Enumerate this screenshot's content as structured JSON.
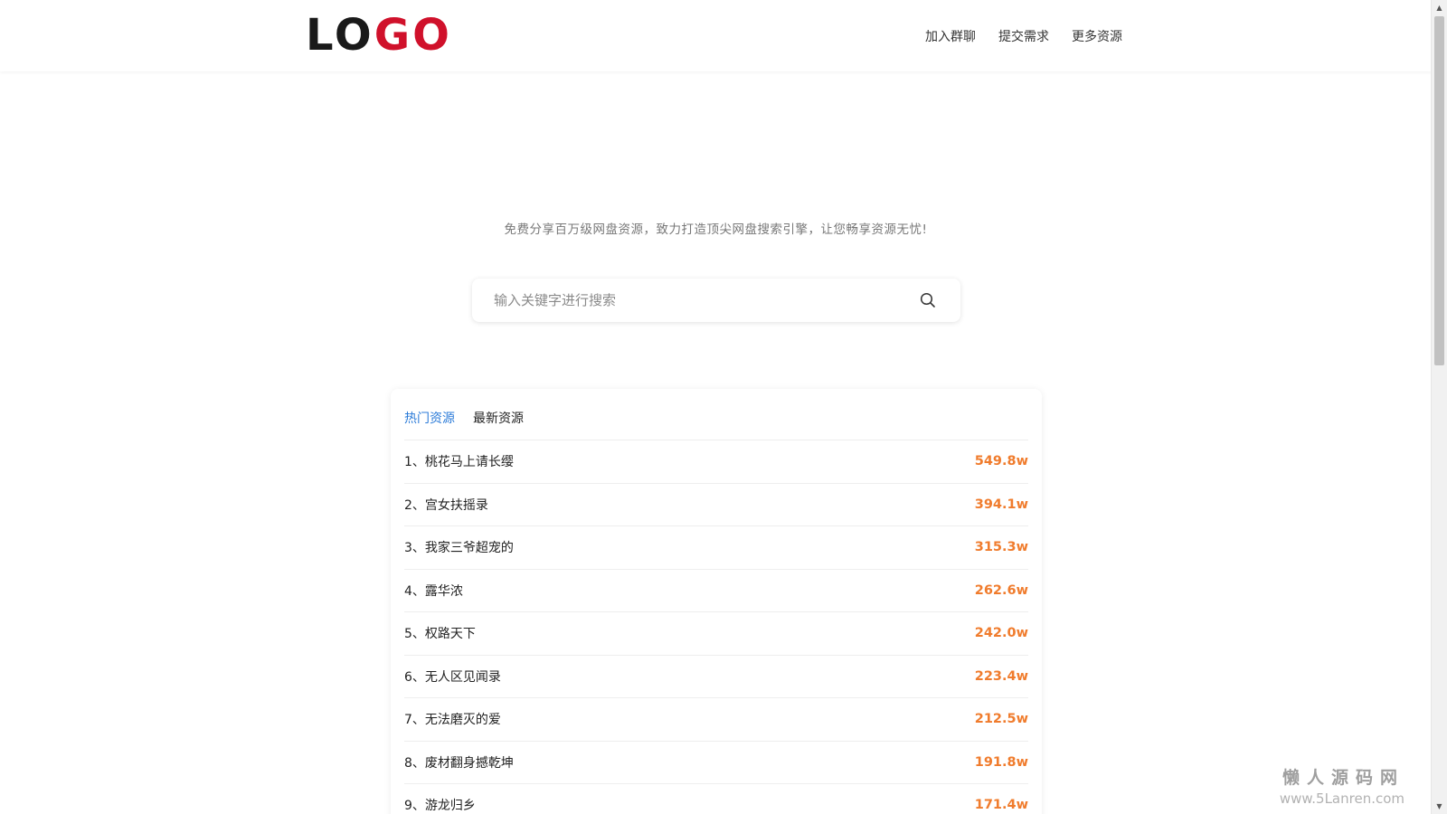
{
  "header": {
    "logo_part1": "LO",
    "logo_part2": "GO",
    "nav": [
      "加入群聊",
      "提交需求",
      "更多资源"
    ]
  },
  "hero": {
    "tagline": "免费分享百万级网盘资源，致力打造顶尖网盘搜索引擎，让您畅享资源无忧!"
  },
  "search": {
    "placeholder": "输入关键字进行搜索",
    "icon": "search-icon"
  },
  "tabs": [
    "热门资源",
    "最新资源"
  ],
  "active_tab": "热门资源",
  "colors": {
    "accent_tab": "#2b7bd8",
    "count": "#f07c2d",
    "logo_red": "#d0112b"
  },
  "hot_list": [
    {
      "title": "1、桃花马上请长缨",
      "count": "549.8w"
    },
    {
      "title": "2、宫女扶摇录",
      "count": "394.1w"
    },
    {
      "title": "3、我家三爷超宠的",
      "count": "315.3w"
    },
    {
      "title": "4、露华浓",
      "count": "262.6w"
    },
    {
      "title": "5、权路天下",
      "count": "242.0w"
    },
    {
      "title": "6、无人区见闻录",
      "count": "223.4w"
    },
    {
      "title": "7、无法磨灭的爱",
      "count": "212.5w"
    },
    {
      "title": "8、废材翻身撼乾坤",
      "count": "191.8w"
    },
    {
      "title": "9、游龙归乡",
      "count": "171.4w"
    }
  ],
  "watermark": {
    "cn": "懒人源码网",
    "url": "www.5Lanren.com"
  }
}
